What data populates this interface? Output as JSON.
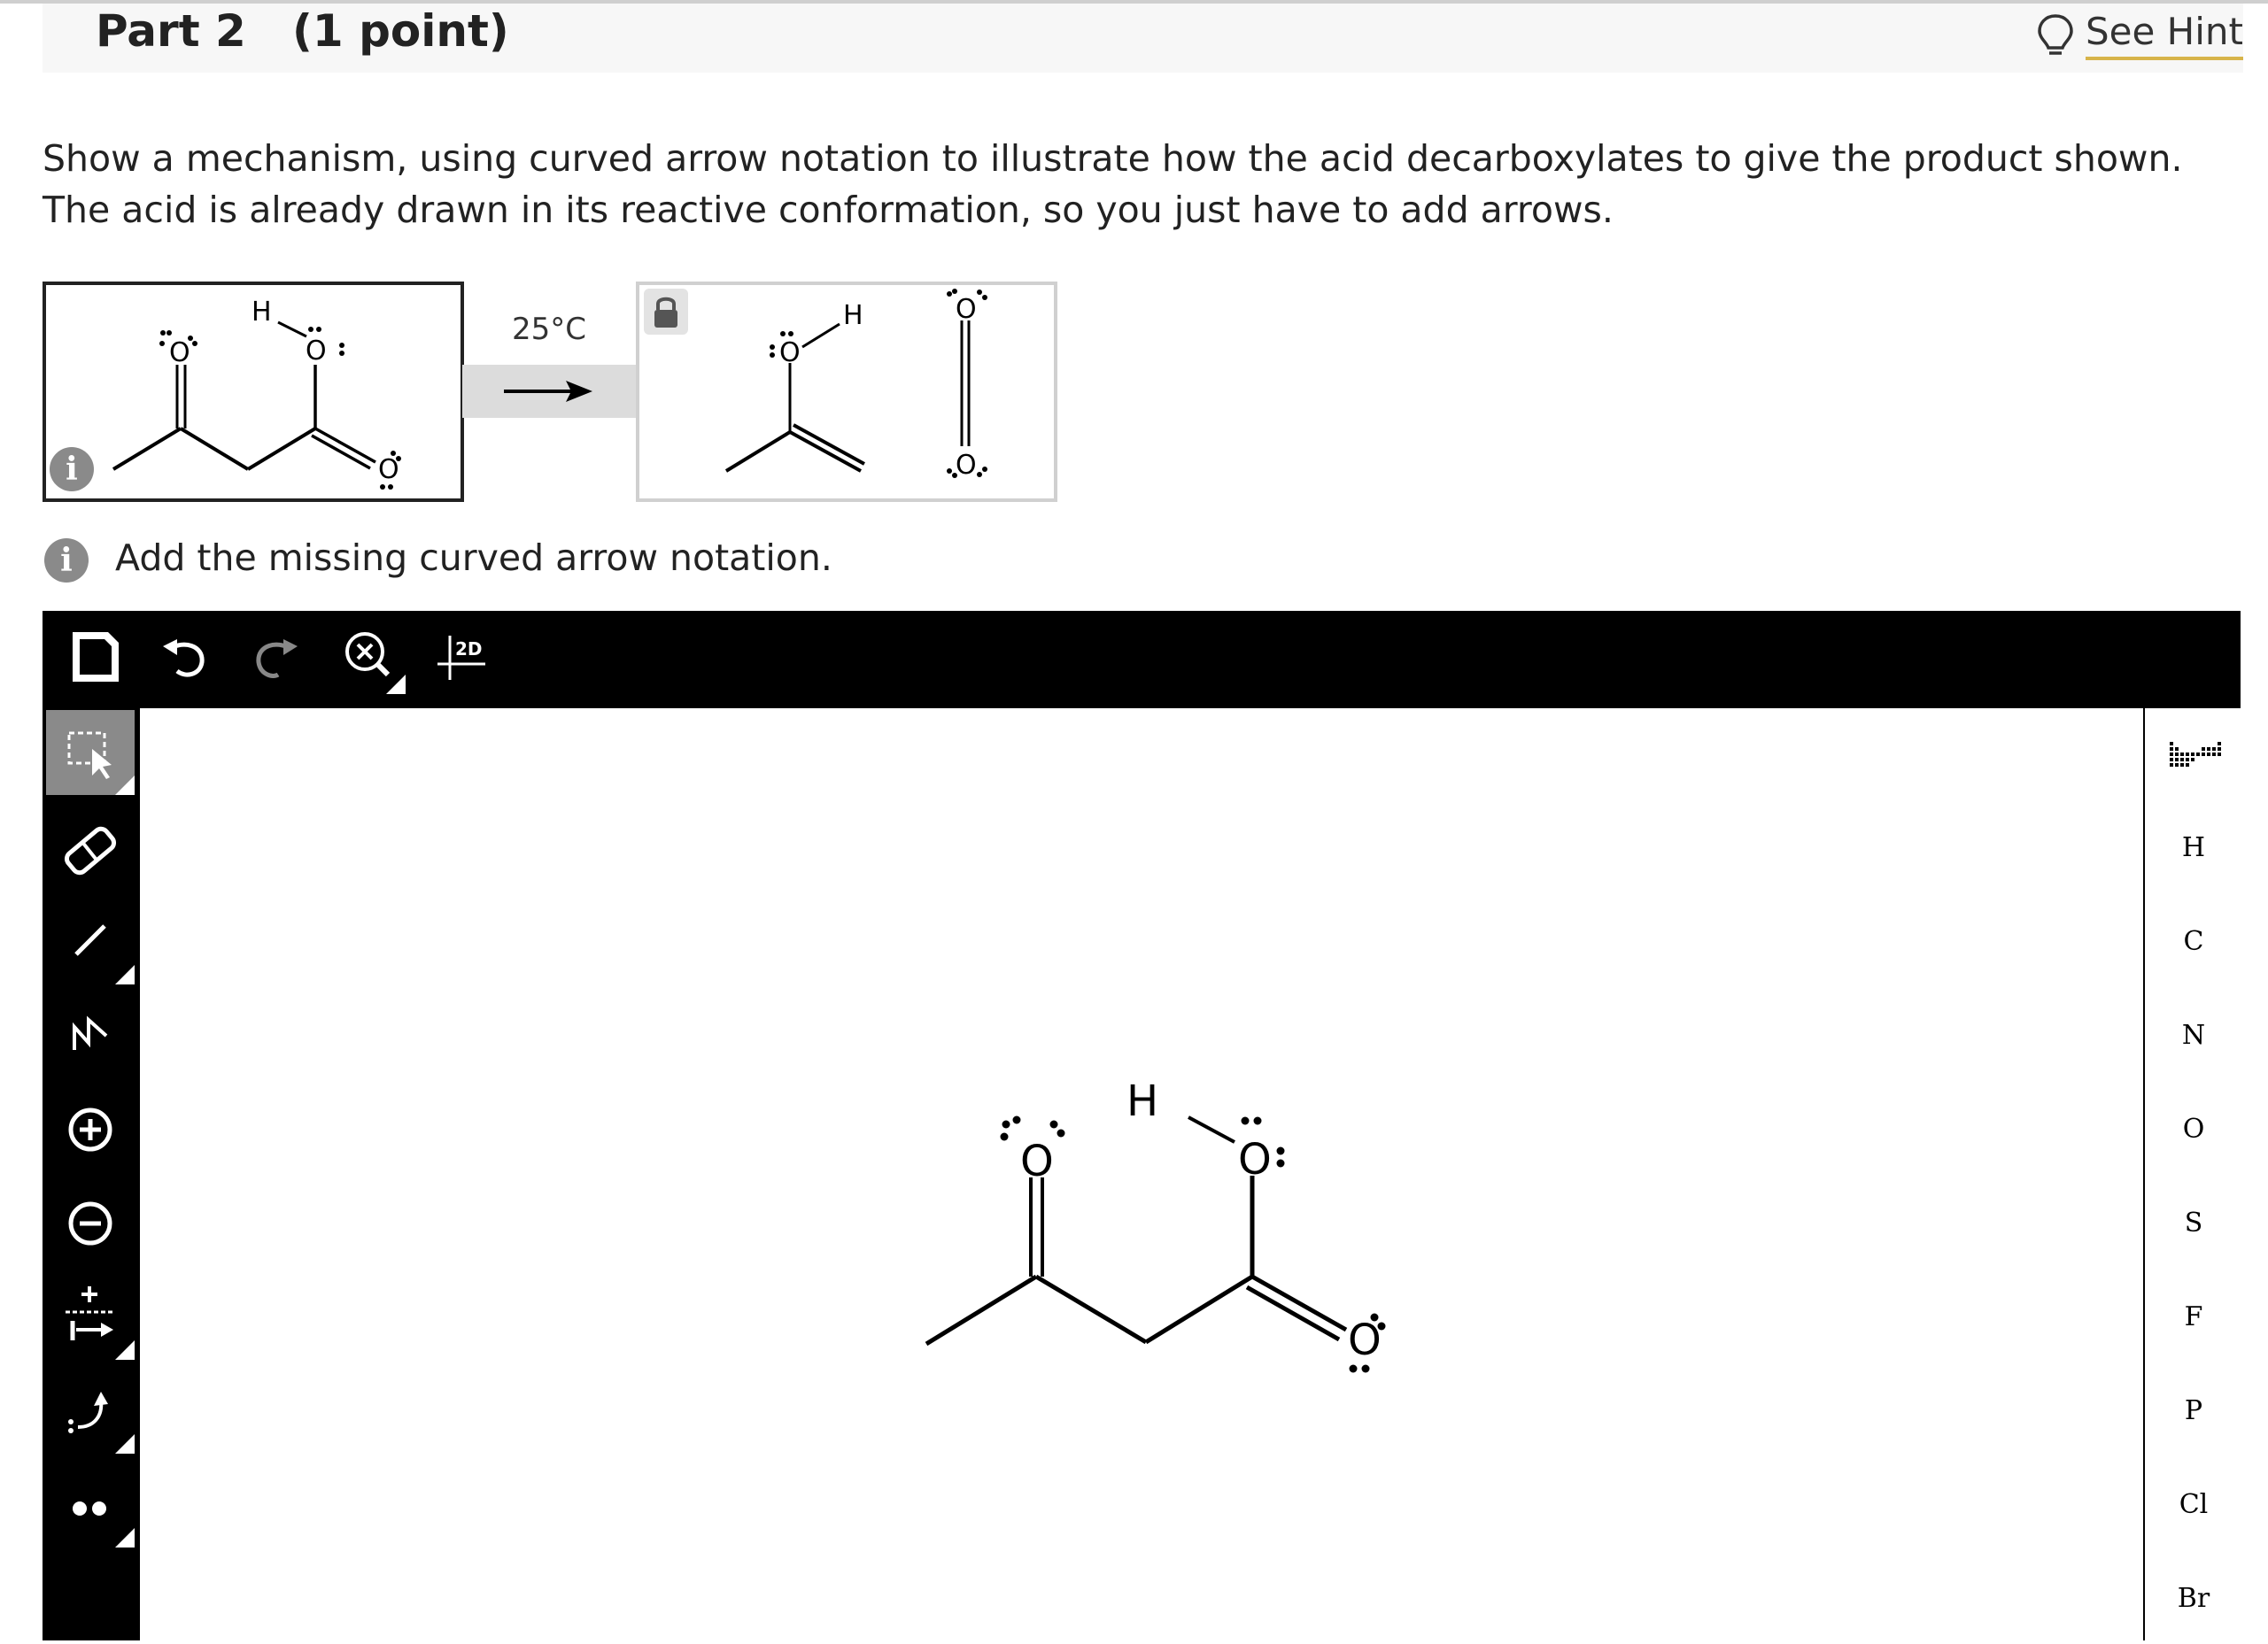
{
  "header": {
    "part_label": "Part 2   (1 point)",
    "hint_label": "See Hint",
    "hint_accent": "#d7b44a"
  },
  "question": {
    "text": "Show a mechanism, using curved arrow notation to illustrate how the acid decarboxylates to give the product shown. The acid is already drawn in its reactive conformation, so you just have to add arrows."
  },
  "reaction": {
    "condition": "25°C",
    "reactant_atoms": {
      "h": "H",
      "o1": "O",
      "o2": "O",
      "o3": "O"
    },
    "product_atoms": {
      "h": "H",
      "o_enol": "O",
      "o_co2_top": "O",
      "o_co2_bottom": "O"
    },
    "info_icon": "info-icon",
    "lock_icon": "lock-icon"
  },
  "instruction": {
    "text": "Add the missing curved arrow notation."
  },
  "editor": {
    "top_toolbar": [
      "new-document-icon",
      "undo-icon",
      "redo-icon",
      "zoom-clear-icon",
      "2d-clean-icon"
    ],
    "clean_label": "2D",
    "left_tools": [
      "selection-tool-icon",
      "eraser-icon",
      "single-bond-icon",
      "chain-icon",
      "positive-charge-icon",
      "negative-charge-icon",
      "reaction-arrow-icon",
      "curved-arrow-icon",
      "lone-pair-icon"
    ],
    "elements": [
      "H",
      "C",
      "N",
      "O",
      "S",
      "F",
      "P",
      "Cl",
      "Br"
    ],
    "canvas_atoms": {
      "h": "H",
      "o1": "O",
      "o2": "O",
      "o3": "O"
    }
  }
}
